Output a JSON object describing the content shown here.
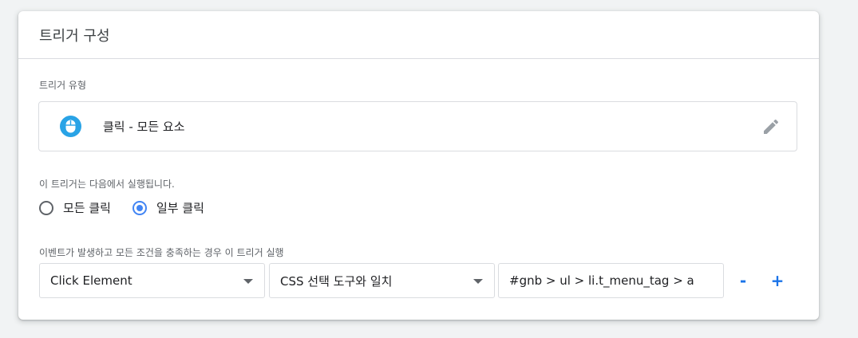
{
  "header": {
    "title": "트리거 구성"
  },
  "trigger_type": {
    "label": "트리거 유형",
    "name": "클릭 - 모든 요소",
    "icon": "mouse-icon",
    "edit_icon": "pencil-icon",
    "icon_color": "#29a3e6"
  },
  "fire_on": {
    "label": "이 트리거는 다음에서 실행됩니다.",
    "options": [
      {
        "label": "모든 클릭",
        "checked": false
      },
      {
        "label": "일부 클릭",
        "checked": true
      }
    ]
  },
  "conditions": {
    "label": "이벤트가 발생하고 모든 조건을 충족하는 경우 이 트리거 실행",
    "variable": "Click Element",
    "operator": "CSS 선택 도구와 일치",
    "value": "#gnb > ul > li.t_menu_tag > a",
    "remove_label": "-",
    "add_label": "+"
  },
  "colors": {
    "accent": "#1a73e8",
    "radio": "#4285f4"
  }
}
